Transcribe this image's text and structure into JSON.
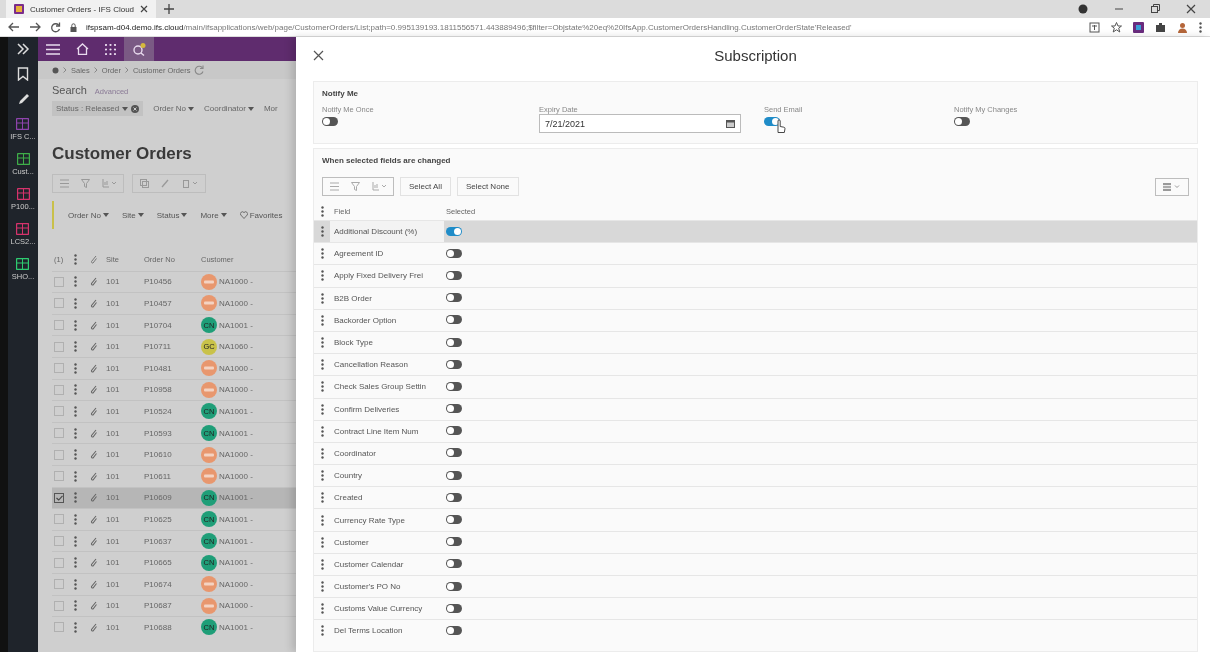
{
  "browser": {
    "tab_title": "Customer Orders - IFS Cloud",
    "url_host": "ifspsam-d04.demo.ifs.cloud",
    "url_path": "/main/ifsapplications/web/page/CustomerOrders/List;path=0.995139193.1811556571.443889496;$filter=Objstate%20eq%20IfsApp.CustomerOrdersHandling.CustomerOrderState'Released'"
  },
  "rail": {
    "items": [
      {
        "label": "IFS C...",
        "color": "#8e44ad"
      },
      {
        "label": "Cust...",
        "color": "#3fae49"
      },
      {
        "label": "P100...",
        "color": "#d6336c"
      },
      {
        "label": "LCS2...",
        "color": "#d6336c"
      },
      {
        "label": "SHO...",
        "color": "#2ecc71"
      }
    ]
  },
  "orders": {
    "breadcrumb": [
      "Sales",
      "Order",
      "Customer Orders"
    ],
    "search_label": "Search",
    "advanced_link": "Advanced",
    "filters": [
      {
        "label": "Status : Released",
        "kind": "active"
      },
      {
        "label": "Order No",
        "kind": "dropdown"
      },
      {
        "label": "Coordinator",
        "kind": "dropdown"
      },
      {
        "label": "Mor",
        "kind": "cut"
      }
    ],
    "title": "Customer Orders",
    "column_filters": [
      {
        "label": "Order No",
        "kind": "dropdown"
      },
      {
        "label": "Site",
        "kind": "dropdown"
      },
      {
        "label": "Status",
        "kind": "dropdown"
      },
      {
        "label": "More",
        "kind": "dropdown"
      },
      {
        "label": "Favorites",
        "kind": "favorites"
      }
    ],
    "selection_count": "(1)",
    "columns": [
      "Site",
      "Order No",
      "Customer"
    ],
    "rows": [
      {
        "selected": false,
        "site": "101",
        "order_no": "P10456",
        "avatar": {
          "kind": "logo",
          "color": "#e8976e"
        },
        "customer": "NA1000 -"
      },
      {
        "selected": false,
        "site": "101",
        "order_no": "P10457",
        "avatar": {
          "kind": "logo",
          "color": "#e8976e"
        },
        "customer": "NA1000 -"
      },
      {
        "selected": false,
        "site": "101",
        "order_no": "P10704",
        "avatar": {
          "kind": "initials",
          "text": "CN",
          "color": "#1f9e78"
        },
        "customer": "NA1001 -"
      },
      {
        "selected": false,
        "site": "101",
        "order_no": "P10711",
        "avatar": {
          "kind": "initials",
          "text": "GC",
          "color": "#c9c24a"
        },
        "customer": "NA1060 -"
      },
      {
        "selected": false,
        "site": "101",
        "order_no": "P10481",
        "avatar": {
          "kind": "logo",
          "color": "#e8976e"
        },
        "customer": "NA1000 -"
      },
      {
        "selected": false,
        "site": "101",
        "order_no": "P10958",
        "avatar": {
          "kind": "logo",
          "color": "#e8976e"
        },
        "customer": "NA1000 -"
      },
      {
        "selected": false,
        "site": "101",
        "order_no": "P10524",
        "avatar": {
          "kind": "initials",
          "text": "CN",
          "color": "#1f9e78"
        },
        "customer": "NA1001 -"
      },
      {
        "selected": false,
        "site": "101",
        "order_no": "P10593",
        "avatar": {
          "kind": "initials",
          "text": "CN",
          "color": "#1f9e78"
        },
        "customer": "NA1001 -"
      },
      {
        "selected": false,
        "site": "101",
        "order_no": "P10610",
        "avatar": {
          "kind": "logo",
          "color": "#e8976e"
        },
        "customer": "NA1000 -"
      },
      {
        "selected": false,
        "site": "101",
        "order_no": "P10611",
        "avatar": {
          "kind": "logo",
          "color": "#e8976e"
        },
        "customer": "NA1000 -"
      },
      {
        "selected": true,
        "site": "101",
        "order_no": "P10609",
        "avatar": {
          "kind": "initials",
          "text": "CN",
          "color": "#1f9e78"
        },
        "customer": "NA1001 -"
      },
      {
        "selected": false,
        "site": "101",
        "order_no": "P10625",
        "avatar": {
          "kind": "initials",
          "text": "CN",
          "color": "#1f9e78"
        },
        "customer": "NA1001 -"
      },
      {
        "selected": false,
        "site": "101",
        "order_no": "P10637",
        "avatar": {
          "kind": "initials",
          "text": "CN",
          "color": "#1f9e78"
        },
        "customer": "NA1001 -"
      },
      {
        "selected": false,
        "site": "101",
        "order_no": "P10665",
        "avatar": {
          "kind": "initials",
          "text": "CN",
          "color": "#1f9e78"
        },
        "customer": "NA1001 -"
      },
      {
        "selected": false,
        "site": "101",
        "order_no": "P10674",
        "avatar": {
          "kind": "logo",
          "color": "#e8976e"
        },
        "customer": "NA1000 -"
      },
      {
        "selected": false,
        "site": "101",
        "order_no": "P10687",
        "avatar": {
          "kind": "logo",
          "color": "#e8976e"
        },
        "customer": "NA1000 -"
      },
      {
        "selected": false,
        "site": "101",
        "order_no": "P10688",
        "avatar": {
          "kind": "initials",
          "text": "CN",
          "color": "#1f9e78"
        },
        "customer": "NA1001 -"
      }
    ]
  },
  "subscription": {
    "title": "Subscription",
    "notify": {
      "title": "Notify Me",
      "notify_once": {
        "label": "Notify Me Once",
        "on": false
      },
      "expiry_date": {
        "label": "Expiry Date",
        "value": "7/21/2021"
      },
      "send_email": {
        "label": "Send Email",
        "on": true
      },
      "notify_my_changes": {
        "label": "Notify My Changes",
        "on": false
      }
    },
    "fields": {
      "title": "When selected fields are changed",
      "buttons": [
        "Select All",
        "Select None"
      ],
      "columns": [
        "Field",
        "Selected"
      ],
      "rows": [
        {
          "name": "Additional Discount (%)",
          "on": true,
          "selected": true
        },
        {
          "name": "Agreement ID",
          "on": false,
          "selected": false
        },
        {
          "name": "Apply Fixed Delivery Frei",
          "on": false,
          "selected": false
        },
        {
          "name": "B2B Order",
          "on": false,
          "selected": false
        },
        {
          "name": "Backorder Option",
          "on": false,
          "selected": false
        },
        {
          "name": "Block Type",
          "on": false,
          "selected": false
        },
        {
          "name": "Cancellation Reason",
          "on": false,
          "selected": false
        },
        {
          "name": "Check Sales Group Settin",
          "on": false,
          "selected": false
        },
        {
          "name": "Confirm Deliveries",
          "on": false,
          "selected": false
        },
        {
          "name": "Contract Line Item Num",
          "on": false,
          "selected": false
        },
        {
          "name": "Coordinator",
          "on": false,
          "selected": false
        },
        {
          "name": "Country",
          "on": false,
          "selected": false
        },
        {
          "name": "Created",
          "on": false,
          "selected": false
        },
        {
          "name": "Currency Rate Type",
          "on": false,
          "selected": false
        },
        {
          "name": "Customer",
          "on": false,
          "selected": false
        },
        {
          "name": "Customer Calendar",
          "on": false,
          "selected": false
        },
        {
          "name": "Customer's PO No",
          "on": false,
          "selected": false
        },
        {
          "name": "Customs Value Currency",
          "on": false,
          "selected": false
        },
        {
          "name": "Del Terms Location",
          "on": false,
          "selected": false
        }
      ]
    }
  }
}
